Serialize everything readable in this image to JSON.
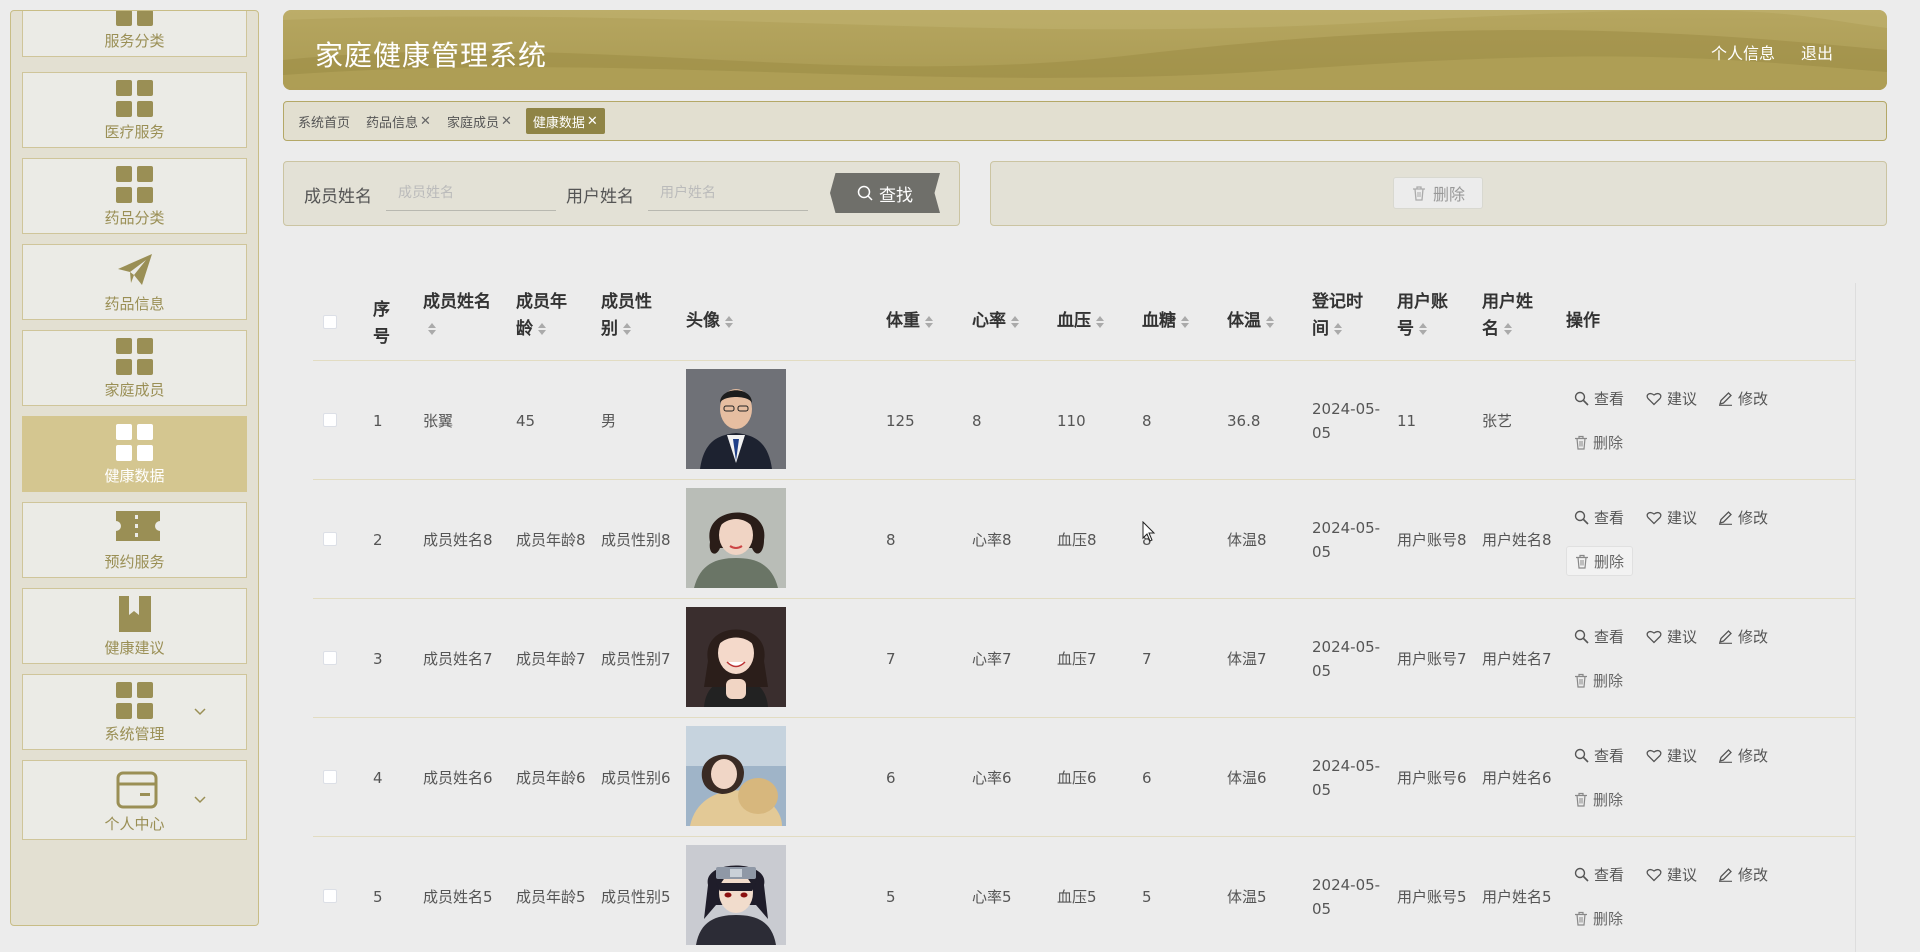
{
  "header": {
    "title": "家庭健康管理系统",
    "profile_link": "个人信息",
    "logout_link": "退出"
  },
  "sidebar": {
    "items": [
      {
        "label": "服务分类",
        "icon": "grid-icon"
      },
      {
        "label": "医疗服务",
        "icon": "grid-icon"
      },
      {
        "label": "药品分类",
        "icon": "grid-icon"
      },
      {
        "label": "药品信息",
        "icon": "paper-plane-icon"
      },
      {
        "label": "家庭成员",
        "icon": "grid-icon"
      },
      {
        "label": "健康数据",
        "icon": "grid-icon",
        "active": true
      },
      {
        "label": "预约服务",
        "icon": "ticket-icon"
      },
      {
        "label": "健康建议",
        "icon": "bookmark-icon"
      },
      {
        "label": "系统管理",
        "icon": "grid-icon",
        "expandable": true
      },
      {
        "label": "个人中心",
        "icon": "card-icon",
        "expandable": true
      }
    ]
  },
  "tags": [
    {
      "label": "系统首页",
      "closable": false
    },
    {
      "label": "药品信息",
      "closable": true
    },
    {
      "label": "家庭成员",
      "closable": true
    },
    {
      "label": "健康数据",
      "closable": true,
      "active": true
    }
  ],
  "search": {
    "member_name_label": "成员姓名",
    "member_name_placeholder": "成员姓名",
    "member_name_value": "",
    "user_name_label": "用户姓名",
    "user_name_placeholder": "用户姓名",
    "user_name_value": "",
    "search_button": "查找"
  },
  "actions": {
    "delete_button": "删除"
  },
  "table": {
    "columns": {
      "index": "序号",
      "member_name": "成员姓名",
      "member_age": "成员年龄",
      "member_gender": "成员性别",
      "avatar": "头像",
      "weight": "体重",
      "heart_rate": "心率",
      "blood_pressure": "血压",
      "blood_sugar": "血糖",
      "temperature": "体温",
      "register_time": "登记时间",
      "user_account": "用户账号",
      "user_name": "用户姓名",
      "operations": "操作"
    },
    "ops": {
      "view": "查看",
      "advice": "建议",
      "edit": "修改",
      "delete": "删除"
    },
    "rows": [
      {
        "index": "1",
        "member_name": "张翼",
        "member_age": "45",
        "member_gender": "男",
        "avatar": "man-in-suit-photo",
        "weight": "125",
        "heart_rate": "8",
        "blood_pressure": "110",
        "blood_sugar": "8",
        "temperature": "36.8",
        "register_time": "2024-05-05",
        "user_account": "11",
        "user_name": "张艺"
      },
      {
        "index": "2",
        "member_name": "成员姓名8",
        "member_age": "成员年龄8",
        "member_gender": "成员性别8",
        "avatar": "woman-short-hair-photo",
        "weight": "8",
        "heart_rate": "心率8",
        "blood_pressure": "血压8",
        "blood_sugar": "8",
        "temperature": "体温8",
        "register_time": "2024-05-05",
        "user_account": "用户账号8",
        "user_name": "用户姓名8"
      },
      {
        "index": "3",
        "member_name": "成员姓名7",
        "member_age": "成员年龄7",
        "member_gender": "成员性别7",
        "avatar": "smiling-girl-photo",
        "weight": "7",
        "heart_rate": "心率7",
        "blood_pressure": "血压7",
        "blood_sugar": "7",
        "temperature": "体温7",
        "register_time": "2024-05-05",
        "user_account": "用户账号7",
        "user_name": "用户姓名7"
      },
      {
        "index": "4",
        "member_name": "成员姓名6",
        "member_age": "成员年龄6",
        "member_gender": "成员性别6",
        "avatar": "girl-with-plush-photo",
        "weight": "6",
        "heart_rate": "心率6",
        "blood_pressure": "血压6",
        "blood_sugar": "6",
        "temperature": "体温6",
        "register_time": "2024-05-05",
        "user_account": "用户账号6",
        "user_name": "用户姓名6"
      },
      {
        "index": "5",
        "member_name": "成员姓名5",
        "member_age": "成员年龄5",
        "member_gender": "成员性别5",
        "avatar": "anime-ninja-avatar",
        "weight": "5",
        "heart_rate": "心率5",
        "blood_pressure": "血压5",
        "blood_sugar": "5",
        "temperature": "体温5",
        "register_time": "2024-05-05",
        "user_account": "用户账号5",
        "user_name": "用户姓名5"
      }
    ]
  },
  "colors": {
    "accent": "#a99a52",
    "active_menu": "#d4c690",
    "active_tag": "#8f8446",
    "search_button": "#6f6f6a"
  }
}
